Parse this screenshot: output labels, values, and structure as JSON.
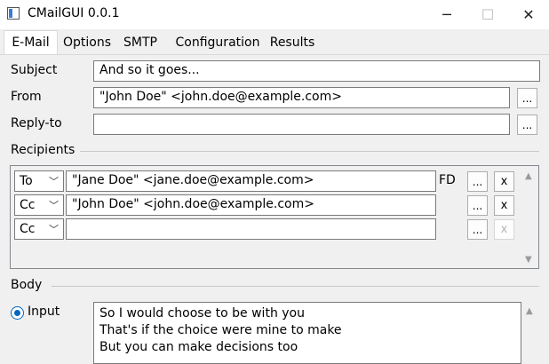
{
  "window": {
    "title": "CMailGUI 0.0.1",
    "minimize_glyph": "─",
    "maximize_glyph": "☐",
    "close_glyph": "✕"
  },
  "tabs": [
    {
      "label": "E-Mail",
      "active": true
    },
    {
      "label": "Options",
      "active": false
    },
    {
      "label": "SMTP",
      "active": false
    },
    {
      "label": "Configuration",
      "active": false
    },
    {
      "label": "Results",
      "active": false
    }
  ],
  "email": {
    "subject_label": "Subject",
    "subject_value": "And so it goes...",
    "from_label": "From",
    "from_value": "\"John Doe\" <john.doe@example.com>",
    "replyto_label": "Reply-to",
    "replyto_value": "",
    "browse_label": "..."
  },
  "recipients": {
    "section_label": "Recipients",
    "rows": [
      {
        "type": "To",
        "address": "\"Jane Doe\" <jane.doe@example.com>",
        "flag": "FD",
        "remove_label": "x",
        "remove_enabled": true
      },
      {
        "type": "Cc",
        "address": "\"John Doe\" <john.doe@example.com>",
        "flag": "",
        "remove_label": "x",
        "remove_enabled": true
      },
      {
        "type": "Cc",
        "address": "",
        "flag": "",
        "remove_label": "x",
        "remove_enabled": false
      }
    ],
    "chevron_glyph": "﹀",
    "scroll_up_glyph": "▲",
    "scroll_down_glyph": "▼"
  },
  "body": {
    "section_label": "Body",
    "input_radio_label": "Input",
    "input_radio_selected": true,
    "text": "So I would choose to be with you\nThat's if the choice were mine to make\nBut you can make decisions too",
    "scroll_up_glyph": "▲"
  },
  "colors": {
    "accent": "#0067c0",
    "window_bg": "#f0f0f0",
    "titlebar_bg": "#ffffff"
  }
}
